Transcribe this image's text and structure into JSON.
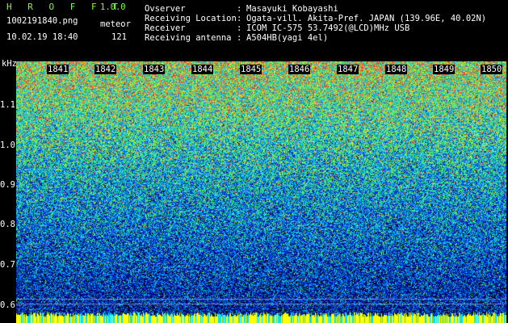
{
  "app": {
    "title": "H R O F F T",
    "version": "1.0.0"
  },
  "capture": {
    "filename": "1002191840.png",
    "datetime": "10.02.19 18:40",
    "meteor_label": "meteor",
    "meteor_count": "121"
  },
  "info": [
    {
      "key": "Ovserver",
      "value": "Masayuki Kobayashi"
    },
    {
      "key": "Receiving Location",
      "value": "Ogata-vill. Akita-Pref. JAPAN (139.96E, 40.02N)"
    },
    {
      "key": "Receiver",
      "value": "ICOM IC-575 53.7492(@LCD)MHz USB"
    },
    {
      "key": "Receiving antenna",
      "value": "A504HB(yagi 4el)"
    }
  ],
  "y_axis": {
    "unit": "kHz",
    "labels": [
      "1.1",
      "1.0",
      "0.9",
      "0.8",
      "0.7",
      "0.6"
    ]
  },
  "x_axis": {
    "labels": [
      "1841",
      "1842",
      "1843",
      "1844",
      "1845",
      "1846",
      "1847",
      "1848",
      "1849",
      "1850"
    ]
  },
  "colors": {
    "accent_green": "#7CFC3A",
    "noise_low": "#000080",
    "noise_mid": "#00A0FF",
    "noise_high": "#FF2020",
    "baseline": "#FFFF00"
  }
}
